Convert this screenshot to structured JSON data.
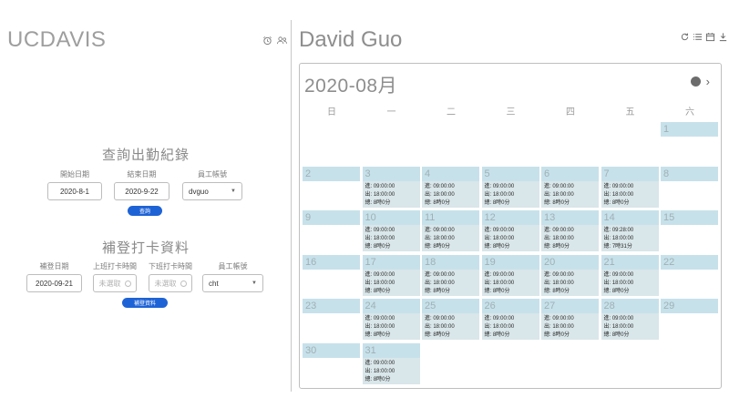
{
  "left": {
    "brand": "UCDAVIS",
    "icons": [
      "alarm-clock-icon",
      "user-group-icon"
    ],
    "query": {
      "title": "查詢出勤紀錄",
      "start_label": "開始日期",
      "start_value": "2020-8-1",
      "end_label": "結束日期",
      "end_value": "2020-9-22",
      "account_label": "員工帳號",
      "account_value": "dvguo",
      "button_label": "查詢"
    },
    "makeup": {
      "title": "補登打卡資料",
      "date_label": "補登日期",
      "date_value": "2020-09-21",
      "in_label": "上班打卡時間",
      "in_placeholder": "未選取",
      "out_label": "下班打卡時間",
      "out_placeholder": "未選取",
      "account_label": "員工帳號",
      "account_value": "cht",
      "button_label": "補登資料"
    }
  },
  "right": {
    "user_name": "David Guo",
    "icons": [
      "refresh-icon",
      "list-icon",
      "calendar-icon",
      "download-icon"
    ],
    "calendar": {
      "month_title": "2020-08月",
      "weekdays": [
        "日",
        "一",
        "二",
        "三",
        "四",
        "五",
        "六"
      ],
      "labels": {
        "in": "進",
        "out": "出",
        "total": "總"
      },
      "days": [
        {
          "day": "1",
          "col": 6,
          "row": 0
        },
        {
          "day": "2",
          "col": 0,
          "row": 1
        },
        {
          "day": "3",
          "col": 1,
          "row": 1,
          "in": "09:00:00",
          "out": "18:00:00",
          "total": "8時0分"
        },
        {
          "day": "4",
          "col": 2,
          "row": 1,
          "in": "09:00:00",
          "out": "18:00:00",
          "total": "8時0分"
        },
        {
          "day": "5",
          "col": 3,
          "row": 1,
          "in": "09:00:00",
          "out": "18:00:00",
          "total": "8時0分"
        },
        {
          "day": "6",
          "col": 4,
          "row": 1,
          "in": "09:00:00",
          "out": "18:00:00",
          "total": "8時0分"
        },
        {
          "day": "7",
          "col": 5,
          "row": 1,
          "in": "09:00:00",
          "out": "18:00:00",
          "total": "8時0分"
        },
        {
          "day": "8",
          "col": 6,
          "row": 1
        },
        {
          "day": "9",
          "col": 0,
          "row": 2
        },
        {
          "day": "10",
          "col": 1,
          "row": 2,
          "in": "09:00:00",
          "out": "18:00:00",
          "total": "8時0分"
        },
        {
          "day": "11",
          "col": 2,
          "row": 2,
          "in": "09:00:00",
          "out": "18:00:00",
          "total": "8時0分"
        },
        {
          "day": "12",
          "col": 3,
          "row": 2,
          "in": "09:00:00",
          "out": "18:00:00",
          "total": "8時0分"
        },
        {
          "day": "13",
          "col": 4,
          "row": 2,
          "in": "09:00:00",
          "out": "18:00:00",
          "total": "8時0分"
        },
        {
          "day": "14",
          "col": 5,
          "row": 2,
          "in": "09:28:00",
          "out": "18:00:00",
          "total": "7時31分"
        },
        {
          "day": "15",
          "col": 6,
          "row": 2
        },
        {
          "day": "16",
          "col": 0,
          "row": 3
        },
        {
          "day": "17",
          "col": 1,
          "row": 3,
          "in": "09:00:00",
          "out": "18:00:00",
          "total": "8時0分"
        },
        {
          "day": "18",
          "col": 2,
          "row": 3,
          "in": "09:00:00",
          "out": "18:00:00",
          "total": "8時0分"
        },
        {
          "day": "19",
          "col": 3,
          "row": 3,
          "in": "09:00:00",
          "out": "18:00:00",
          "total": "8時0分"
        },
        {
          "day": "20",
          "col": 4,
          "row": 3,
          "in": "09:00:00",
          "out": "18:00:00",
          "total": "8時0分"
        },
        {
          "day": "21",
          "col": 5,
          "row": 3,
          "in": "09:00:00",
          "out": "18:00:00",
          "total": "8時0分"
        },
        {
          "day": "22",
          "col": 6,
          "row": 3
        },
        {
          "day": "23",
          "col": 0,
          "row": 4
        },
        {
          "day": "24",
          "col": 1,
          "row": 4,
          "in": "09:00:00",
          "out": "18:00:00",
          "total": "8時0分"
        },
        {
          "day": "25",
          "col": 2,
          "row": 4,
          "in": "09:00:00",
          "out": "18:00:00",
          "total": "8時0分"
        },
        {
          "day": "26",
          "col": 3,
          "row": 4,
          "in": "09:00:00",
          "out": "18:00:00",
          "total": "8時0分"
        },
        {
          "day": "27",
          "col": 4,
          "row": 4,
          "in": "09:00:00",
          "out": "18:00:00",
          "total": "8時0分"
        },
        {
          "day": "28",
          "col": 5,
          "row": 4,
          "in": "09:00:00",
          "out": "18:00:00",
          "total": "8時0分"
        },
        {
          "day": "29",
          "col": 6,
          "row": 4
        },
        {
          "day": "30",
          "col": 0,
          "row": 5
        },
        {
          "day": "31",
          "col": 1,
          "row": 5,
          "in": "09:00:00",
          "out": "18:00:00",
          "total": "8時0分"
        }
      ]
    }
  },
  "colors": {
    "accent": "#1e63d6",
    "day_header": "#c7e1ea",
    "day_body": "#d9e6ea"
  }
}
